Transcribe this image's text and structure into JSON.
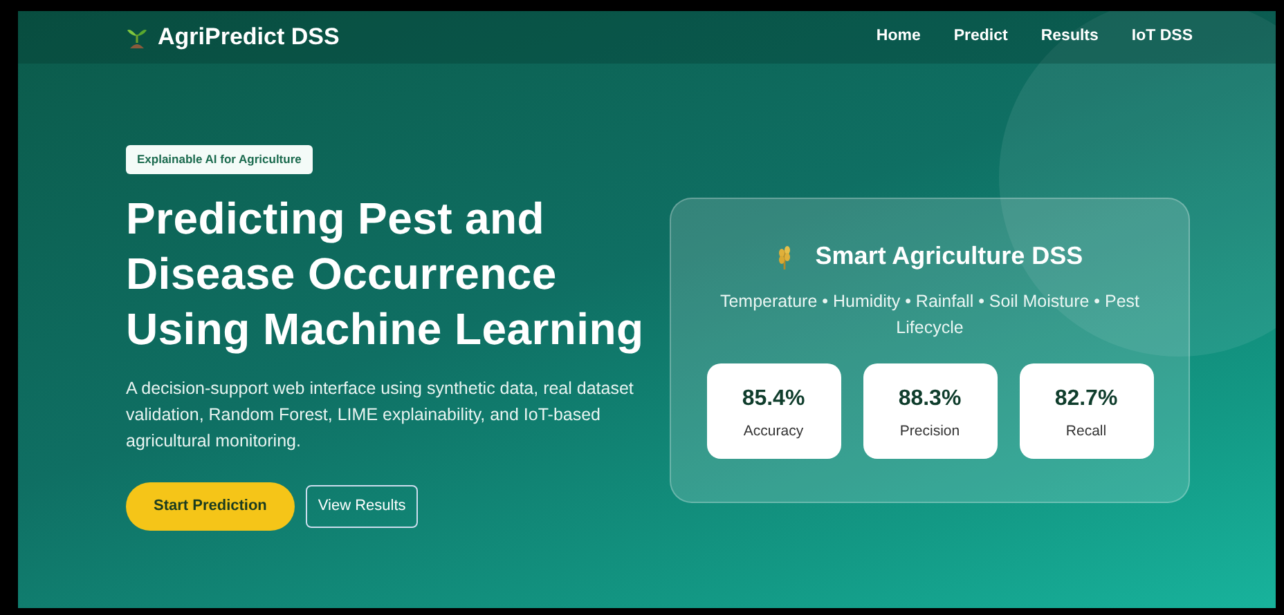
{
  "navbar": {
    "brand": "AgriPredict DSS",
    "links": [
      {
        "label": "Home"
      },
      {
        "label": "Predict"
      },
      {
        "label": "Results"
      },
      {
        "label": "IoT DSS"
      }
    ]
  },
  "hero": {
    "badge": "Explainable AI for Agriculture",
    "title": "Predicting Pest and Disease Occurrence Using Machine Learning",
    "description": "A decision-support web interface using synthetic data, real dataset validation, Random Forest, LIME explainability, and IoT-based agricultural monitoring.",
    "buttons": [
      {
        "label": "Start Prediction",
        "kind": "primary"
      },
      {
        "label": "View Results",
        "kind": "outline"
      }
    ]
  },
  "card": {
    "title": "Smart Agriculture DSS",
    "subtitle": "Temperature • Humidity • Rainfall • Soil Moisture • Pest Lifecycle",
    "metrics": [
      {
        "value": "85.4%",
        "label": "Accuracy"
      },
      {
        "value": "88.3%",
        "label": "Precision"
      },
      {
        "value": "82.7%",
        "label": "Recall"
      }
    ]
  }
}
